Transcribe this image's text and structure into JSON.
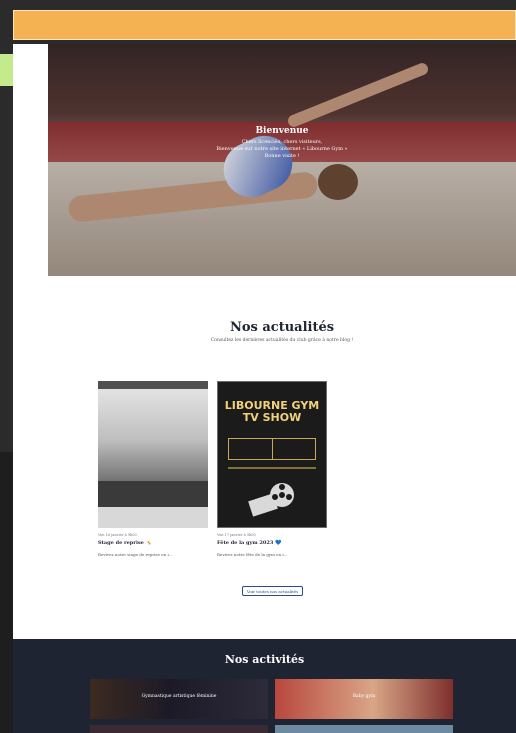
{
  "hero": {
    "title": "Bienvenue",
    "line1": "Chers licenciés, chers visiteurs,",
    "line2": "Bienvenue sur notre site internet « Libourne Gym »",
    "line3": "Bonne visite !"
  },
  "news": {
    "title": "Nos actualités",
    "subtitle": "Consultez les dernières actualités du club grâce à notre blog !",
    "cards": [
      {
        "date": "Ven 16 janvier à 9h00",
        "title": "Stage de reprise 🤸",
        "excerpt": "Revivez notre stage de reprise en i..."
      },
      {
        "date": "Ven 17 janvier à 9h00",
        "title": "Fête de la gym 2023 💙",
        "excerpt": "Revivez notre fête de la gym en i..."
      }
    ],
    "poster": {
      "title_line1": "LIBOURNE GYM",
      "title_line2": "TV SHOW"
    },
    "see_all": "Voir toutes nos actualités"
  },
  "activities": {
    "title": "Nos activités",
    "tiles": [
      {
        "label": "Gymnastique artistique féminine"
      },
      {
        "label": "Baby gym"
      },
      {
        "label": ""
      },
      {
        "label": ""
      }
    ]
  },
  "colors": {
    "topbar": "#f4b252",
    "green_tab": "#c4ea8d",
    "dark_section": "#1f2433",
    "link_blue": "#2b4a8a"
  }
}
